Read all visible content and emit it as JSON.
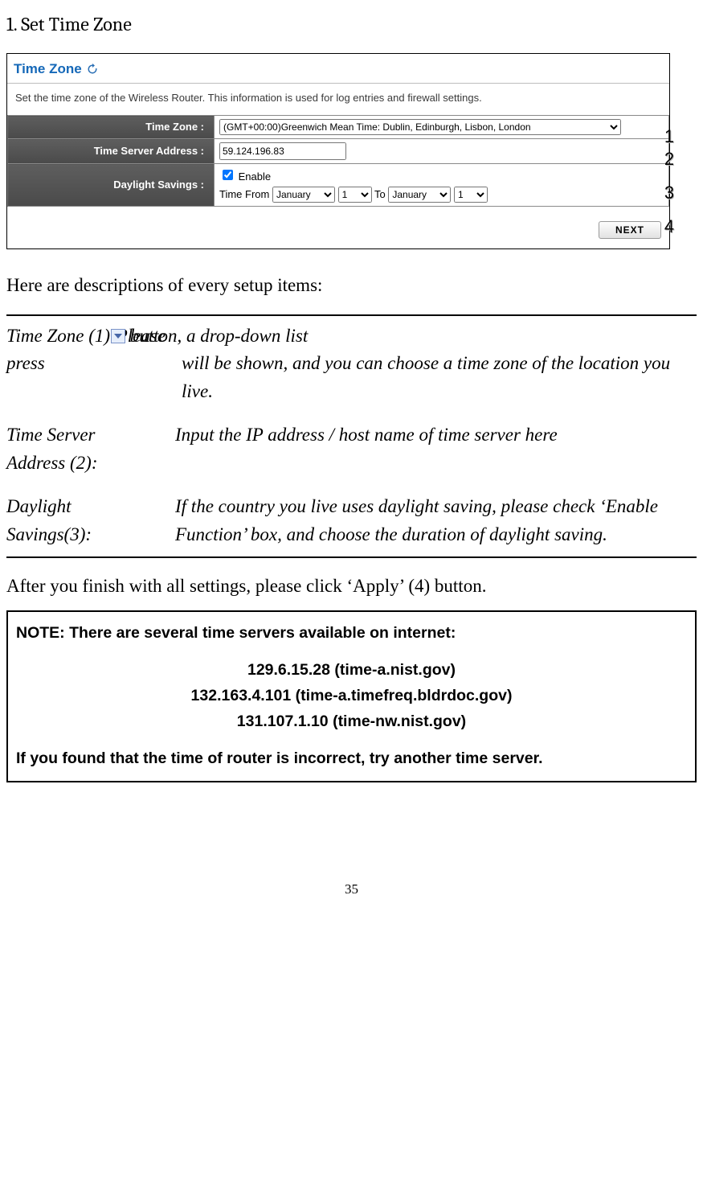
{
  "heading": "1. Set Time Zone",
  "screenshot": {
    "title": "Time Zone",
    "description": "Set the time zone of the Wireless Router. This information is used for log entries and firewall settings.",
    "rows": {
      "time_zone": {
        "label": "Time Zone :",
        "value": "(GMT+00:00)Greenwich Mean Time: Dublin, Edinburgh, Lisbon, London"
      },
      "time_server": {
        "label": "Time Server Address :",
        "value": "59.124.196.83"
      },
      "daylight": {
        "label": "Daylight Savings :",
        "enable_label": "Enable",
        "from_label": "Time From",
        "month_from": "January",
        "day_from": "1",
        "to_label": "To",
        "month_to": "January",
        "day_to": "1"
      }
    },
    "next_button": "NEXT",
    "callouts": {
      "c1": "1",
      "c2": "2",
      "c3": "3",
      "c4": "4"
    }
  },
  "intro_line": "Here are descriptions of every setup items:",
  "descriptions": {
    "tz": {
      "label": "Time Zone (1):",
      "first_line_prefix": "Please press ",
      "first_line_suffix": " button, a drop-down list",
      "rest": "will be shown, and you can choose a time zone of the location you live."
    },
    "ts": {
      "label_line1": "Time Server",
      "label_line2": "Address (2):",
      "text": "Input the IP address / host name of time server here"
    },
    "ds": {
      "label_line1": "Daylight",
      "label_line2": "Savings(3):",
      "text": "If the country you live uses daylight saving, please check ‘Enable Function’ box, and choose the duration of daylight saving."
    }
  },
  "after_line": "After you finish with all settings, please click ‘Apply’ (4) button.",
  "note": {
    "heading": "NOTE: There are several time servers available on internet:",
    "servers": [
      "129.6.15.28 (time-a.nist.gov)",
      "132.163.4.101 (time-a.timefreq.bldrdoc.gov)",
      "131.107.1.10 (time-nw.nist.gov)"
    ],
    "footer": "If you found that the time of router is incorrect, try another time server."
  },
  "page_number": "35"
}
